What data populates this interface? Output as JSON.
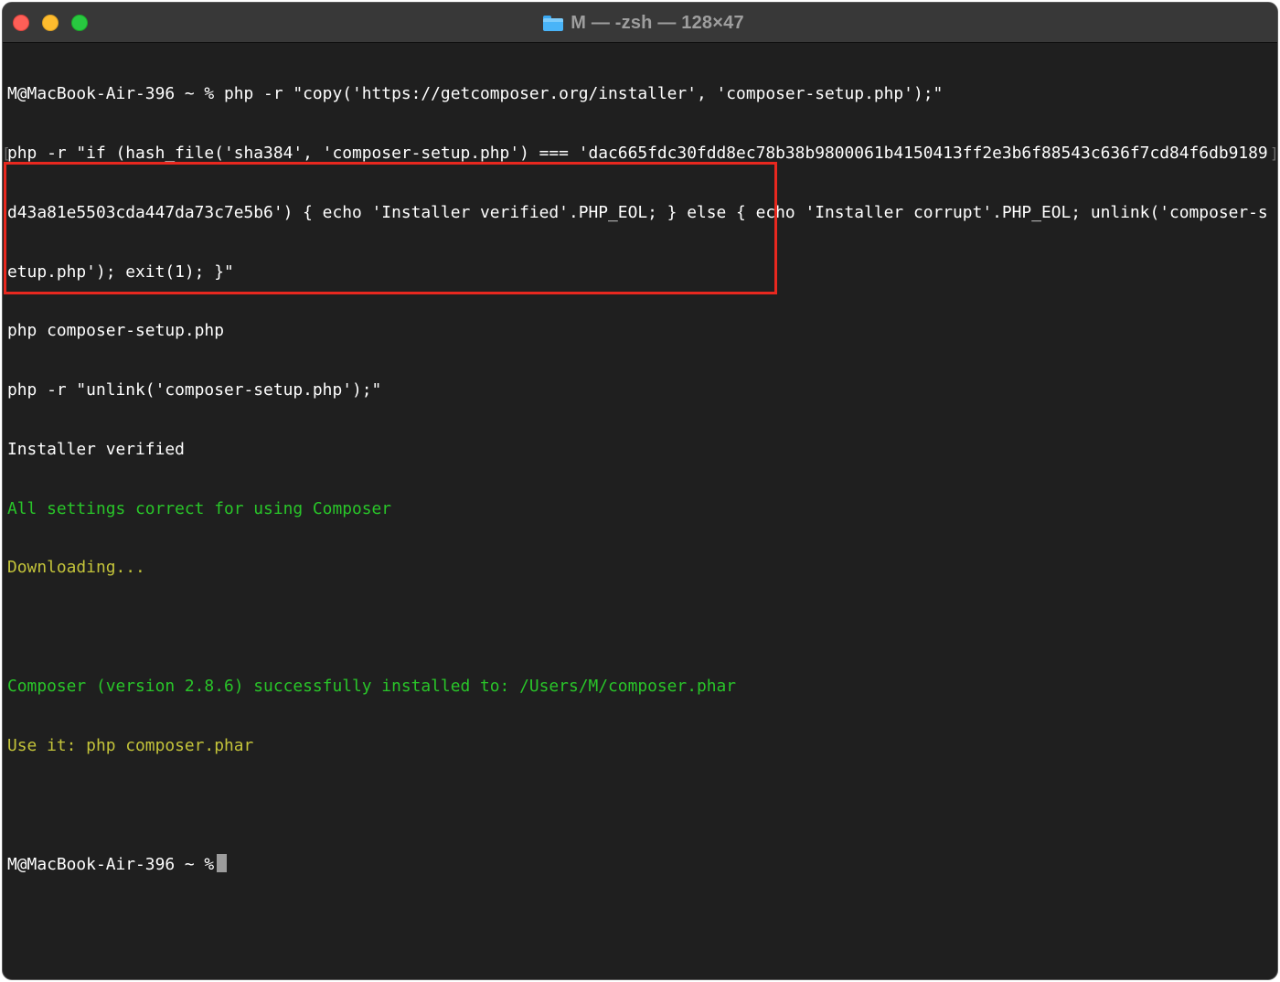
{
  "window": {
    "title": "M — -zsh — 128×47",
    "title_icon": "folder-icon"
  },
  "traffic_lights": {
    "close": "close-button",
    "minimize": "minimize-button",
    "zoom": "zoom-button"
  },
  "terminal": {
    "lines": [
      {
        "text": "M@MacBook-Air-396 ~ % php -r \"copy('https://getcomposer.org/installer', 'composer-setup.php');\"",
        "color": "white"
      },
      {
        "text": "php -r \"if (hash_file('sha384', 'composer-setup.php') === 'dac665fdc30fdd8ec78b38b9800061b4150413ff2e3b6f88543c636f7cd84f6db9189",
        "color": "white"
      },
      {
        "text": "d43a81e5503cda447da73c7e5b6') { echo 'Installer verified'.PHP_EOL; } else { echo 'Installer corrupt'.PHP_EOL; unlink('composer-s",
        "color": "white"
      },
      {
        "text": "etup.php'); exit(1); }\"",
        "color": "white"
      },
      {
        "text": "php composer-setup.php",
        "color": "white"
      },
      {
        "text": "php -r \"unlink('composer-setup.php');\"",
        "color": "white"
      },
      {
        "text": "Installer verified",
        "color": "white"
      },
      {
        "text": "All settings correct for using Composer",
        "color": "green"
      },
      {
        "text": "Downloading...",
        "color": "yellow"
      },
      {
        "text": "",
        "color": "white"
      },
      {
        "text": "Composer (version 2.8.6) successfully installed to: /Users/M/composer.phar",
        "color": "green"
      },
      {
        "text": "Use it: php composer.phar",
        "color": "yellow"
      },
      {
        "text": "",
        "color": "white"
      }
    ],
    "prompt": "M@MacBook-Air-396 ~ %",
    "mark_left": "[",
    "mark_right": "]"
  },
  "colors": {
    "background": "#1f1f1f",
    "titlebar": "#383838",
    "text_white": "#ffffff",
    "text_green": "#29c529",
    "text_yellow": "#c4c43a",
    "highlight_border": "#e8281f",
    "cursor": "#9c9c9c"
  }
}
